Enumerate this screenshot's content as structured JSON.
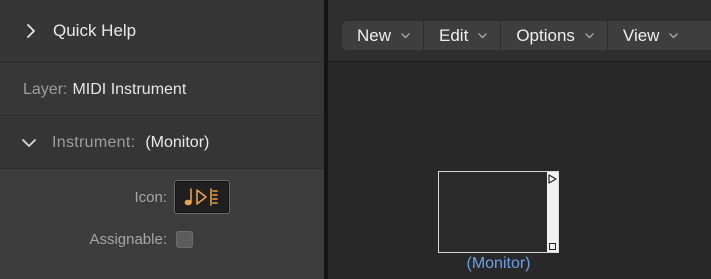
{
  "inspector": {
    "quick_help": {
      "label": "Quick Help",
      "icon": "chevron-right-icon"
    },
    "layer": {
      "key": "Layer:",
      "value": "MIDI Instrument"
    },
    "instrument": {
      "key": "Instrument:",
      "value": "(Monitor)",
      "icon": "chevron-down-icon"
    },
    "params": {
      "icon_label": "Icon:",
      "icon_name": "midi-monitor-icon",
      "assignable_label": "Assignable:",
      "assignable_checked": false
    }
  },
  "toolbar": {
    "menus": [
      {
        "label": "New"
      },
      {
        "label": "Edit"
      },
      {
        "label": "Options"
      },
      {
        "label": "View"
      }
    ]
  },
  "canvas": {
    "object": {
      "name": "(Monitor)"
    }
  },
  "colors": {
    "accent_link": "#6e9fe6",
    "icon_orange": "#e8a14a"
  }
}
